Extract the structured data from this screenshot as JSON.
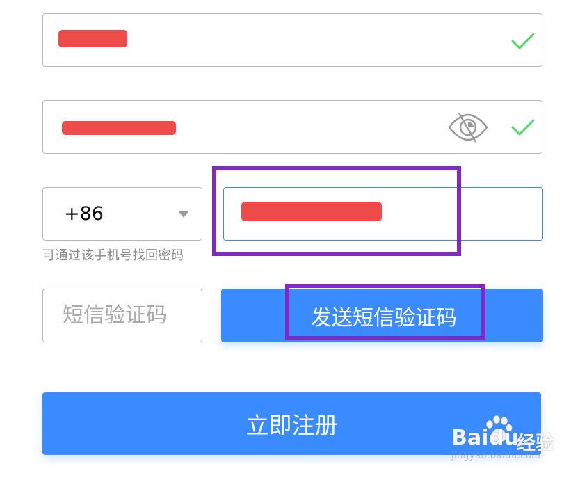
{
  "form": {
    "username_value": "",
    "password_value": "",
    "phone_value": "",
    "country_code": "+86",
    "phone_hint": "可通过该手机号找回密码",
    "sms_code_placeholder": "短信验证码",
    "send_sms_label": "发送短信验证码",
    "register_label": "立即注册"
  },
  "icons": {
    "valid": "check-icon",
    "hide_password": "eye-slash-icon",
    "dropdown": "triangle-down-icon"
  },
  "colors": {
    "primary": "#3a8bff",
    "valid": "#4cd964",
    "redaction": "#ee4b4b",
    "annotation": "#8228c4",
    "focus_border": "#3c8ce6"
  },
  "watermark": {
    "logo_bai": "Bai",
    "logo_du": "du",
    "logo_jingyan": "经验",
    "url": "jingyan.baidu.com"
  }
}
